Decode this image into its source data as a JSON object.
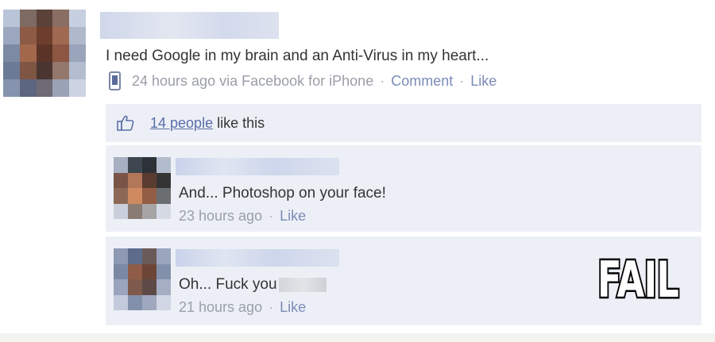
{
  "post": {
    "text": "I need Google in my brain and an Anti-Virus in my heart...",
    "time": "24 hours ago via Facebook for iPhone",
    "separator": "·",
    "comment_link": "Comment",
    "like_link": "Like"
  },
  "likes": {
    "count_link": "14 people",
    "suffix": " like this"
  },
  "comments": [
    {
      "text": "And... Photoshop on your face!",
      "time": "23 hours ago",
      "like_link": "Like"
    },
    {
      "text": "Oh... Fuck you",
      "time": "21 hours ago",
      "like_link": "Like"
    }
  ],
  "stamp": {
    "text": "FAIL"
  },
  "icons": {
    "phone": "mobile-phone-icon",
    "thumb": "thumbs-up-icon"
  },
  "colors": {
    "link": "#7b8bb8",
    "comment_bg": "#ecf0f6",
    "meta_text": "#9a9ea7"
  }
}
